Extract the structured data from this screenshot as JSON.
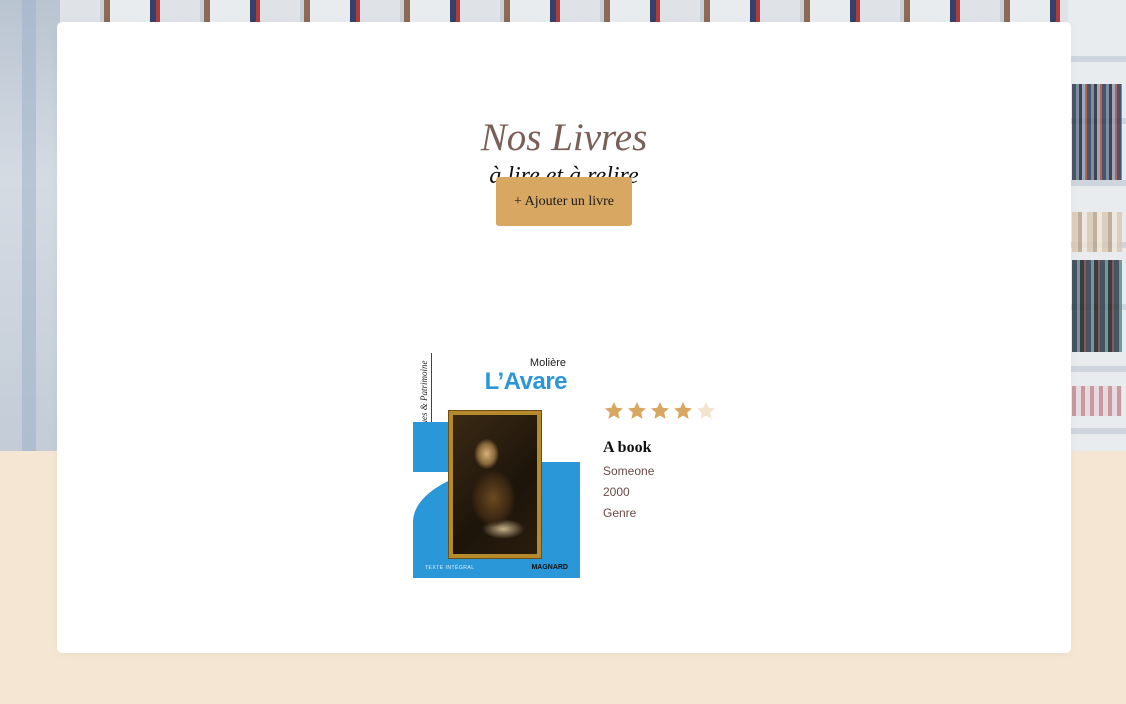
{
  "header": {
    "title": "Nos Livres",
    "subtitle": "à lire et à relire",
    "add_button_label": "+ Ajouter un livre"
  },
  "books": [
    {
      "cover": {
        "series_text": "Classiques & Patrimoine",
        "author": "Molière",
        "title": "L’Avare",
        "footer_left": "TEXTE INTÉGRAL",
        "publisher": "MAGNARD"
      },
      "rating": 4,
      "rating_max": 5,
      "title": "A book",
      "author": "Someone",
      "year": "2000",
      "genre": "Genre"
    }
  ],
  "colors": {
    "accent": "#d8a761",
    "title": "#7a5f57",
    "meta": "#6a4a45",
    "page_background": "#f4e6d2",
    "cover_blue": "#2a97d9",
    "star_empty": "#f3e4cf"
  }
}
